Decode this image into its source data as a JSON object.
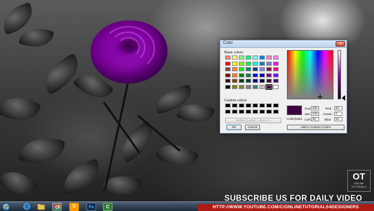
{
  "dialog": {
    "title": "Color",
    "close_label": "x",
    "basic_colors_label": "Basic colors:",
    "custom_colors_label": "Custom colors:",
    "define_custom_label": "Define Custom Colors >>",
    "ok_label": "OK",
    "cancel_label": "Cancel",
    "color_solid_label": "Color|Solid",
    "add_custom_label": "Add to Custom Colors",
    "hue_label": "Hue:",
    "hue_value": "200",
    "sat_label": "Sat:",
    "sat_value": "240",
    "lum_label": "Lum:",
    "lum_value": "30",
    "red_label": "Red:",
    "red_value": "64",
    "green_label": "Green:",
    "green_value": "0",
    "blue_label": "Blue:",
    "blue_value": "64",
    "preview_color": "#400040",
    "basic_colors": [
      "#ff8080",
      "#ffff80",
      "#80ff80",
      "#00ff80",
      "#80ffff",
      "#0080ff",
      "#ff80c0",
      "#ff80ff",
      "#ff0000",
      "#ffff00",
      "#80ff00",
      "#00ff40",
      "#00ffff",
      "#0080c0",
      "#8080c0",
      "#ff00ff",
      "#804040",
      "#ff8040",
      "#00ff00",
      "#008080",
      "#004080",
      "#8080ff",
      "#800040",
      "#ff0080",
      "#800000",
      "#ff8000",
      "#008000",
      "#008040",
      "#0000ff",
      "#0000a0",
      "#800080",
      "#8000ff",
      "#400000",
      "#804000",
      "#004000",
      "#004040",
      "#000080",
      "#000040",
      "#400040",
      "#400080",
      "#000000",
      "#808000",
      "#808040",
      "#808080",
      "#408080",
      "#c0c0c0",
      "#400040",
      "#ffffff"
    ],
    "selected_swatch_index": 46,
    "custom_colors": [
      "#000000",
      "#000000",
      "#000000",
      "#000000",
      "#000000",
      "#000000",
      "#000000",
      "#000000",
      "#000000",
      "#000000",
      "#000000",
      "#000000",
      "#000000",
      "#000000",
      "#000000",
      "#000000"
    ]
  },
  "watermark": {
    "logo_text": "OT",
    "logo_sub": "ONLINE TUTORIALS",
    "subscribe_text": "SUBSCRIBE US FOR DAILY VIDEO",
    "url_text": "HTTP://WWW.YOUTUBE.COM/C/ONLINETUTORIALS4DESIGNERS"
  },
  "taskbar": {
    "icons": [
      "start-orb-icon",
      "internet-explorer-icon",
      "file-explorer-icon",
      "chrome-icon",
      "sublime-text-icon",
      "photoshop-icon",
      "camtasia-icon"
    ],
    "photoshop_label": "Ps",
    "camtasia_label": "C"
  },
  "colors": {
    "rose": "#8b00b3",
    "banner_red": "#b01a14"
  }
}
